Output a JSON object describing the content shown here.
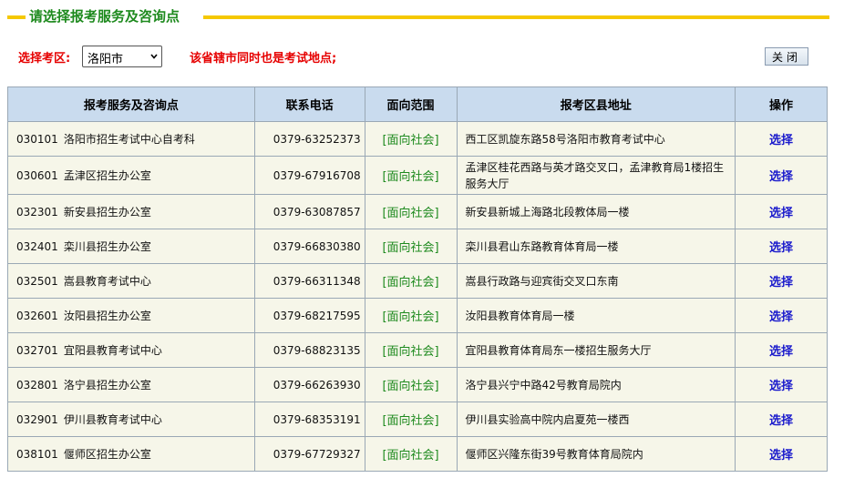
{
  "header": {
    "title": "请选择报考服务及咨询点"
  },
  "controls": {
    "region_label": "选择考区:",
    "region_selected": "洛阳市",
    "notice": "该省辖市同时也是考试地点;",
    "close_label": "关闭"
  },
  "table": {
    "columns": [
      "报考服务及咨询点",
      "联系电话",
      "面向范围",
      "报考区县地址",
      "操作"
    ],
    "rows": [
      {
        "code": "030101",
        "name": "洛阳市招生考试中心自考科",
        "phone": "0379-63252373",
        "scope": "[面向社会]",
        "address": "西工区凯旋东路58号洛阳市教育考试中心",
        "action": "选择"
      },
      {
        "code": "030601",
        "name": "孟津区招生办公室",
        "phone": "0379-67916708",
        "scope": "[面向社会]",
        "address": "孟津区桂花西路与英才路交叉口，孟津教育局1楼招生服务大厅",
        "action": "选择"
      },
      {
        "code": "032301",
        "name": "新安县招生办公室",
        "phone": "0379-63087857",
        "scope": "[面向社会]",
        "address": "新安县新城上海路北段教体局一楼",
        "action": "选择"
      },
      {
        "code": "032401",
        "name": "栾川县招生办公室",
        "phone": "0379-66830380",
        "scope": "[面向社会]",
        "address": "栾川县君山东路教育体育局一楼",
        "action": "选择"
      },
      {
        "code": "032501",
        "name": "嵩县教育考试中心",
        "phone": "0379-66311348",
        "scope": "[面向社会]",
        "address": "嵩县行政路与迎宾街交叉口东南",
        "action": "选择"
      },
      {
        "code": "032601",
        "name": "汝阳县招生办公室",
        "phone": "0379-68217595",
        "scope": "[面向社会]",
        "address": "汝阳县教育体育局一楼",
        "action": "选择"
      },
      {
        "code": "032701",
        "name": "宜阳县教育考试中心",
        "phone": "0379-68823135",
        "scope": "[面向社会]",
        "address": "宜阳县教育体育局东一楼招生服务大厅",
        "action": "选择"
      },
      {
        "code": "032801",
        "name": "洛宁县招生办公室",
        "phone": "0379-66263930",
        "scope": "[面向社会]",
        "address": "洛宁县兴宁中路42号教育局院内",
        "action": "选择"
      },
      {
        "code": "032901",
        "name": "伊川县教育考试中心",
        "phone": "0379-68353191",
        "scope": "[面向社会]",
        "address": "伊川县实验高中院内启夏苑一楼西",
        "action": "选择"
      },
      {
        "code": "038101",
        "name": "偃师区招生办公室",
        "phone": "0379-67729327",
        "scope": "[面向社会]",
        "address": "偃师区兴隆东街39号教育体育局院内",
        "action": "选择"
      }
    ]
  },
  "colors": {
    "title_green": "#1e8a1e",
    "title_line": "#f5c800",
    "alert_red": "#e60000",
    "header_bg": "#c9dbee",
    "row_bg": "#f6f6e9",
    "link_blue": "#1a1acc"
  }
}
